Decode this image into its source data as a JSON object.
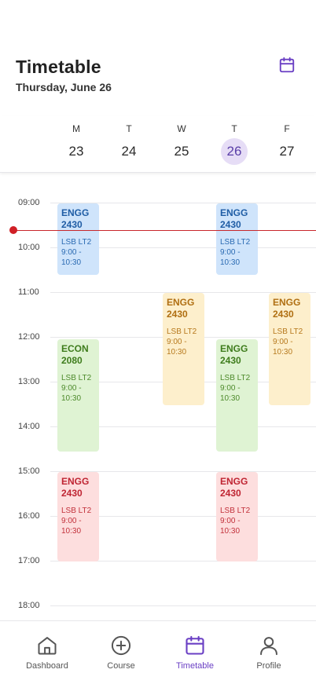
{
  "header": {
    "title": "Timetable",
    "date": "Thursday, June 26",
    "calendar_icon": "calendar-icon"
  },
  "week": {
    "days": [
      {
        "letter": "M",
        "number": "23",
        "selected": false
      },
      {
        "letter": "T",
        "number": "24",
        "selected": false
      },
      {
        "letter": "W",
        "number": "25",
        "selected": false
      },
      {
        "letter": "T",
        "number": "26",
        "selected": true
      },
      {
        "letter": "F",
        "number": "27",
        "selected": false
      }
    ]
  },
  "hours": [
    "09:00",
    "10:00",
    "11:00",
    "12:00",
    "13:00",
    "14:00",
    "15:00",
    "16:00",
    "17:00",
    "18:00"
  ],
  "events": [
    {
      "code": "ENGG 2430",
      "location": "LSB LT2",
      "time": "9:00 - 10:30",
      "color": "blue"
    },
    {
      "code": "ENGG 2430",
      "location": "LSB LT2",
      "time": "9:00 - 10:30",
      "color": "blue"
    },
    {
      "code": "ENGG 2430",
      "location": "LSB LT2",
      "time": "9:00 - 10:30",
      "color": "yellow"
    },
    {
      "code": "ENGG 2430",
      "location": "LSB LT2",
      "time": "9:00 - 10:30",
      "color": "yellow"
    },
    {
      "code": "ECON 2080",
      "location": "LSB LT2",
      "time": "9:00 - 10:30",
      "color": "green"
    },
    {
      "code": "ENGG 2430",
      "location": "LSB LT2",
      "time": "9:00 - 10:30",
      "color": "green"
    },
    {
      "code": "ENGG 2430",
      "location": "LSB LT2",
      "time": "9:00 - 10:30",
      "color": "red"
    },
    {
      "code": "ENGG 2430",
      "location": "LSB LT2",
      "time": "9:00 - 10:30",
      "color": "red"
    }
  ],
  "colors": {
    "accent": "#6a3fc4",
    "selected_day_bg": "#e6ddf6",
    "now_line": "#d01f26",
    "event_blue": "#cfe4fb",
    "event_yellow": "#fdefcc",
    "event_green": "#dff3d3",
    "event_red": "#fddede"
  },
  "nav": {
    "items": [
      {
        "label": "Dashboard",
        "icon": "home-icon",
        "active": false
      },
      {
        "label": "Course",
        "icon": "plus-circle-icon",
        "active": false
      },
      {
        "label": "Timetable",
        "icon": "calendar-icon",
        "active": true
      },
      {
        "label": "Profile",
        "icon": "person-icon",
        "active": false
      }
    ]
  }
}
